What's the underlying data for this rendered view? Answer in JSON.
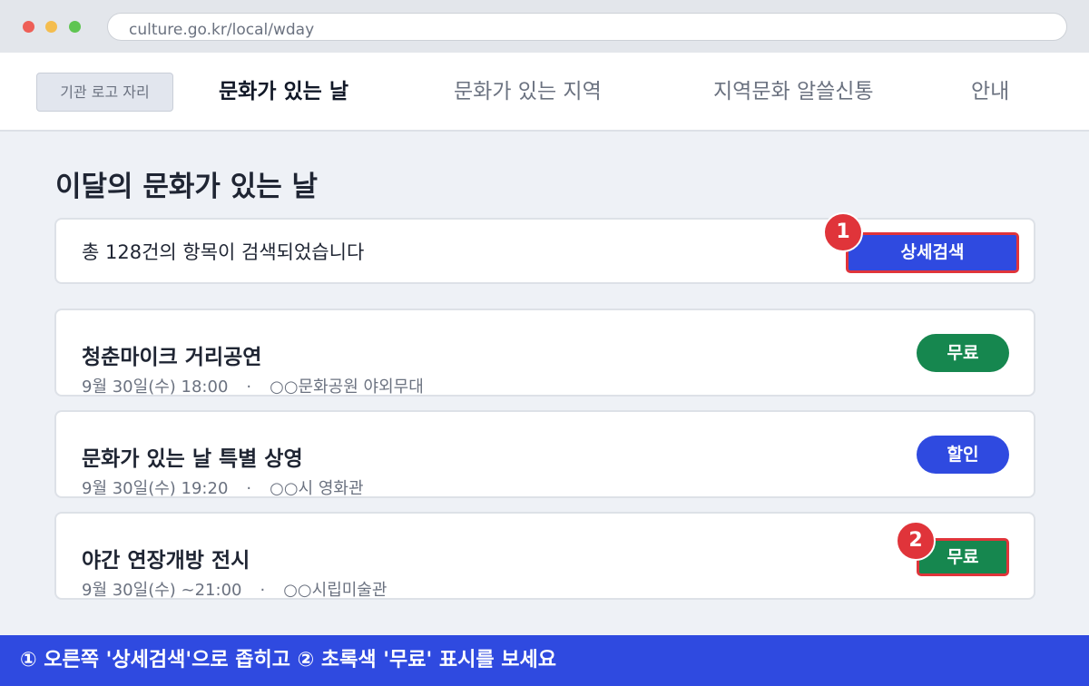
{
  "browser": {
    "url": "culture.go.kr/local/wday"
  },
  "nav": {
    "logo_label": "기관 로고 자리",
    "items": [
      {
        "label": "문화가 있는 날"
      },
      {
        "label": "문화가 있는 지역"
      },
      {
        "label": "지역문화 알쓸신통"
      },
      {
        "label": "안내"
      }
    ]
  },
  "main": {
    "title": "이달의 문화가 있는 날",
    "results_text": "총 128건의 항목이 검색되었습니다",
    "search_button_label": "상세검색"
  },
  "callouts": {
    "first": "1",
    "second": "2"
  },
  "events": [
    {
      "title": "청춘마이크 거리공연",
      "date": "9월 30일(수) 18:00",
      "separator": "·",
      "venue": "○○문화공원 야외무대",
      "badge": "무료"
    },
    {
      "title": "문화가 있는 날 특별 상영",
      "date": "9월 30일(수) 19:20",
      "separator": "·",
      "venue": "○○시 영화관",
      "badge": "할인"
    },
    {
      "title": "야간 연장개방 전시",
      "date": "9월 30일(수) ~21:00",
      "separator": "·",
      "venue": "○○시립미술관",
      "badge": "무료"
    }
  ],
  "instruction": "① 오른쪽 '상세검색'으로 좁히고 ② 초록색 '무료' 표시를 보세요",
  "colors": {
    "accent_blue": "#2f4ae0",
    "free_green": "#16874f",
    "callout_red": "#e0343a"
  }
}
